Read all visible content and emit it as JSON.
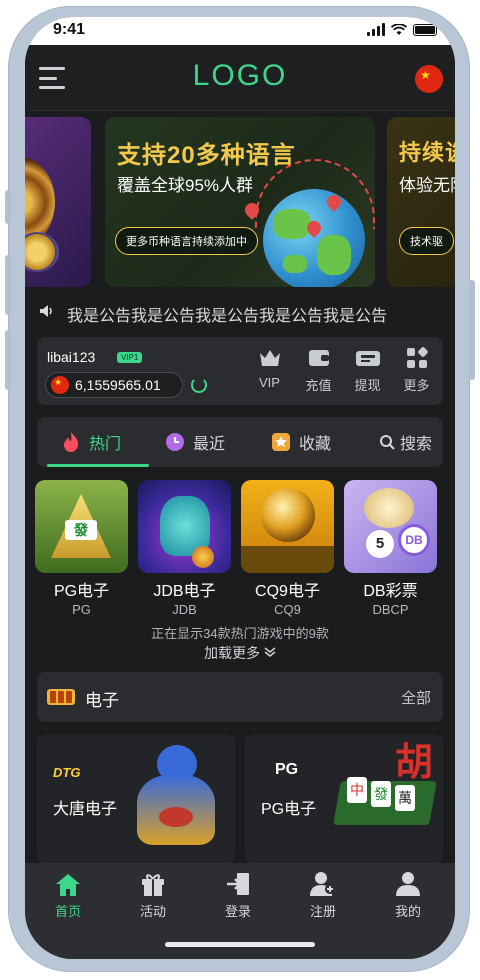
{
  "status_bar": {
    "time": "9:41"
  },
  "header": {
    "logo": "LOGO",
    "flag_icon": "china-flag-icon"
  },
  "banners": {
    "main": {
      "title": "支持20多种语言",
      "subtitle": "覆盖全球95%人群",
      "pill": "更多币种语言持续添加中"
    },
    "right": {
      "title": "持续谈",
      "subtitle": "体验无阻",
      "pill": "技术驱"
    }
  },
  "notice": {
    "text": "我是公告我是公告我是公告我是公告我是公告"
  },
  "account": {
    "username": "libai123",
    "vip_badge": "VIP1",
    "balance": "6,1559565.01",
    "actions": [
      {
        "label": "VIP",
        "icon": "crown-icon"
      },
      {
        "label": "充值",
        "icon": "wallet-icon"
      },
      {
        "label": "提现",
        "icon": "withdraw-icon"
      },
      {
        "label": "更多",
        "icon": "grid-icon"
      }
    ]
  },
  "tabs": [
    {
      "label": "热门",
      "icon": "fire-icon",
      "active": true
    },
    {
      "label": "最近",
      "icon": "clock-icon"
    },
    {
      "label": "收藏",
      "icon": "star-icon"
    },
    {
      "label": "搜索",
      "icon": "search-icon"
    }
  ],
  "games": [
    {
      "name": "PG电子",
      "code": "PG"
    },
    {
      "name": "JDB电子",
      "code": "JDB"
    },
    {
      "name": "CQ9电子",
      "code": "CQ9"
    },
    {
      "name": "DB彩票",
      "code": "DBCP"
    }
  ],
  "games_info": {
    "showing": "正在显示34款热门游戏中的9款",
    "load_more": "加载更多"
  },
  "section": {
    "title": "电子",
    "all": "全部"
  },
  "providers": [
    {
      "logo": "DTG",
      "name": "大唐电子"
    },
    {
      "logo": "PG",
      "name": "PG电子"
    }
  ],
  "tabbar": [
    {
      "label": "首页",
      "icon": "home-icon",
      "active": true
    },
    {
      "label": "活动",
      "icon": "gift-icon"
    },
    {
      "label": "登录",
      "icon": "login-icon"
    },
    {
      "label": "注册",
      "icon": "register-icon"
    },
    {
      "label": "我的",
      "icon": "user-icon"
    }
  ],
  "colors": {
    "accent": "#3dd68c",
    "gold": "#f2c94c",
    "background": "#1b1c1e"
  }
}
